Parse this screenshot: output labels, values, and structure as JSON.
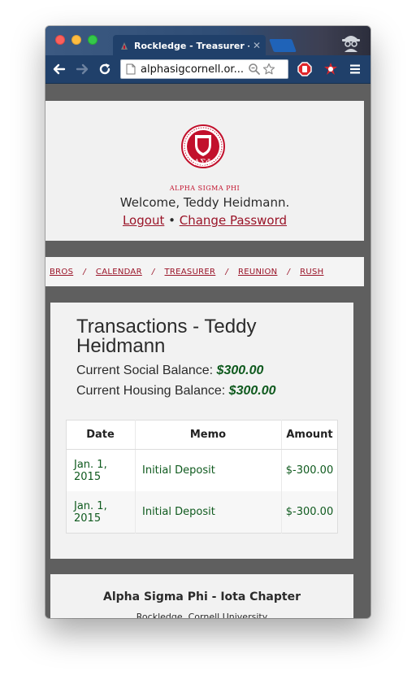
{
  "browser": {
    "tab_title": "Rockledge - Treasurer - Teddy",
    "url": "alphasigcornell.or...",
    "colors": {
      "chrome_dark": "#20406a",
      "accent_red": "#c2102c"
    }
  },
  "header": {
    "crest_name": "crest-logo",
    "org_name": "ALPHA SIGMA PHI",
    "welcome": "Welcome, Teddy Heidmann.",
    "logout_label": "Logout",
    "bullet": "•",
    "change_password_label": "Change Password"
  },
  "nav": {
    "items": [
      {
        "label": "BROS"
      },
      {
        "label": "CALENDAR"
      },
      {
        "label": "TREASURER"
      },
      {
        "label": "REUNION"
      },
      {
        "label": "RUSH"
      }
    ],
    "separator": "/"
  },
  "main": {
    "title": "Transactions - Teddy Heidmann",
    "social_label": "Current Social Balance:",
    "social_value": "$300.00",
    "housing_label": "Current Housing Balance:",
    "housing_value": "$300.00",
    "table": {
      "headers": [
        "Date",
        "Memo",
        "Amount"
      ],
      "rows": [
        {
          "date": "Jan. 1, 2015",
          "memo": "Initial Deposit",
          "amount": "$-300.00"
        },
        {
          "date": "Jan. 1, 2015",
          "memo": "Initial Deposit",
          "amount": "$-300.00"
        }
      ]
    }
  },
  "footer": {
    "title": "Alpha Sigma Phi - Iota Chapter",
    "subtitle": "Rockledge, Cornell University"
  }
}
